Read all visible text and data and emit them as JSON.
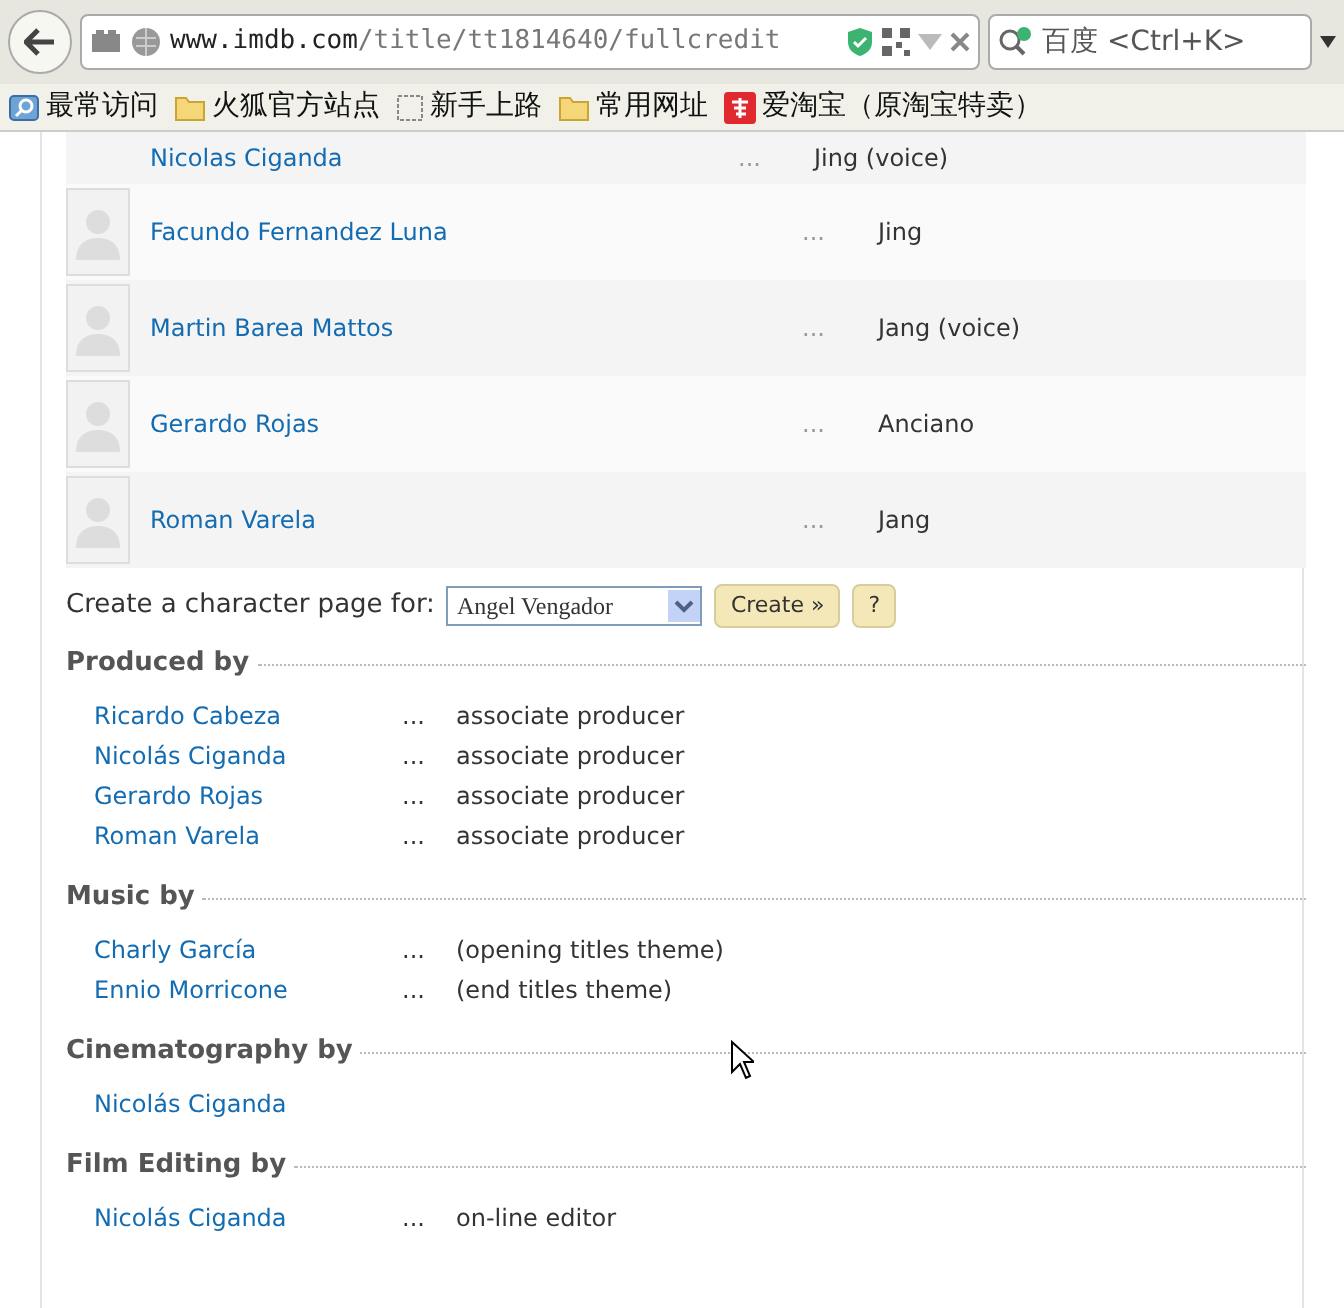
{
  "browser": {
    "url_host": "www.imdb.com",
    "url_path": "/title/tt1814640/fullcredit",
    "search_placeholder": "百度 <Ctrl+K>"
  },
  "bookmarks": [
    {
      "label": "最常访问",
      "kind": "search"
    },
    {
      "label": "火狐官方站点",
      "kind": "folder"
    },
    {
      "label": "新手上路",
      "kind": "page"
    },
    {
      "label": "常用网址",
      "kind": "folder"
    },
    {
      "label": "爱淘宝（原淘宝特卖）",
      "kind": "taobao"
    }
  ],
  "cast": [
    {
      "name": "Nicolas Ciganda",
      "character": "Jing (voice)",
      "partial": true
    },
    {
      "name": "Facundo Fernandez Luna",
      "character": "Jing",
      "partial": false
    },
    {
      "name": "Martin Barea Mattos",
      "character": "Jang (voice)",
      "partial": false
    },
    {
      "name": "Gerardo Rojas",
      "character": "Anciano",
      "partial": false
    },
    {
      "name": "Roman Varela",
      "character": "Jang",
      "partial": false
    }
  ],
  "character_form": {
    "label": "Create a character page for:",
    "value": "Angel Vengador",
    "button": "Create »",
    "help": "?"
  },
  "sections": [
    {
      "title": "Produced by",
      "credits": [
        {
          "name": "Ricardo Cabeza",
          "role": "associate producer"
        },
        {
          "name": "Nicolás Ciganda",
          "role": "associate producer"
        },
        {
          "name": "Gerardo Rojas",
          "role": "associate producer"
        },
        {
          "name": "Roman Varela",
          "role": "associate producer"
        }
      ]
    },
    {
      "title": "Music by",
      "credits": [
        {
          "name": "Charly García",
          "role": "(opening titles theme)"
        },
        {
          "name": "Ennio Morricone",
          "role": "(end titles theme)"
        }
      ]
    },
    {
      "title": "Cinematography by",
      "credits": [
        {
          "name": "Nicolás Ciganda"
        }
      ]
    },
    {
      "title": "Film Editing by",
      "credits": [
        {
          "name": "Nicolás Ciganda",
          "role": "on-line editor"
        }
      ]
    }
  ],
  "ellipsis": "..."
}
